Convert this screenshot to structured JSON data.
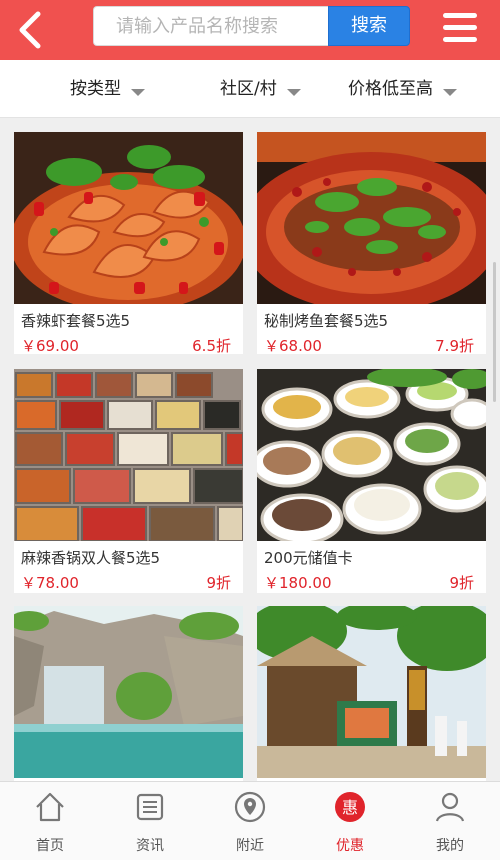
{
  "header": {
    "search_placeholder": "请输入产品名称搜索",
    "search_button": "搜索",
    "accent_color": "#f0514f"
  },
  "filters": [
    {
      "label": "按类型"
    },
    {
      "label": "社区/村"
    },
    {
      "label": "价格低至高"
    }
  ],
  "products": [
    {
      "name": "香辣虾套餐5选5",
      "price": "￥69.00",
      "discount": "6.5折",
      "image": "shrimp-dish"
    },
    {
      "name": "秘制烤鱼套餐5选5",
      "price": "￥68.00",
      "discount": "7.9折",
      "image": "grilled-fish"
    },
    {
      "name": "麻辣香锅双人餐5选5",
      "price": "￥78.00",
      "discount": "9折",
      "image": "hotpot-ingredients"
    },
    {
      "name": "200元储值卡",
      "price": "￥180.00",
      "discount": "9折",
      "image": "buffet-bowls"
    },
    {
      "name": "",
      "price": "",
      "discount": "",
      "image": "waterfall-rocks"
    },
    {
      "name": "",
      "price": "",
      "discount": "",
      "image": "thatched-entrance"
    }
  ],
  "bottom_nav": [
    {
      "label": "首页",
      "icon": "home-icon"
    },
    {
      "label": "资讯",
      "icon": "news-icon"
    },
    {
      "label": "附近",
      "icon": "location-icon"
    },
    {
      "label": "优惠",
      "icon": "discount-icon",
      "active": true
    },
    {
      "label": "我的",
      "icon": "user-icon"
    }
  ]
}
